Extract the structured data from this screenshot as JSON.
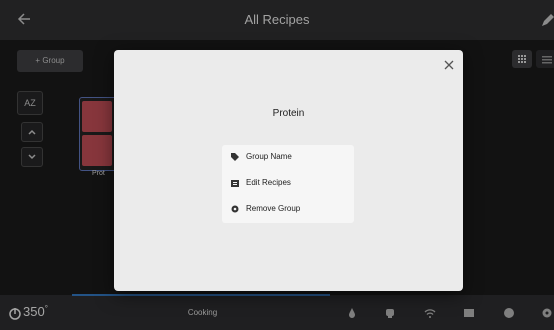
{
  "header": {
    "title": "All Recipes",
    "back_icon": "arrow-left-icon",
    "edit_icon": "pencil-icon"
  },
  "toolbar": {
    "add_group_label": "+ Group",
    "sort_label": "AZ"
  },
  "groups": [
    {
      "label": "Prot"
    }
  ],
  "modal": {
    "title": "Protein",
    "menu": [
      {
        "label": "Group Name",
        "icon": "tag-icon"
      },
      {
        "label": "Edit Recipes",
        "icon": "edit-list-icon"
      },
      {
        "label": "Remove Group",
        "icon": "gear-icon"
      }
    ]
  },
  "bottombar": {
    "temperature": "350",
    "temperature_unit": "°",
    "status": "Cooking"
  },
  "colors": {
    "accent": "#2f6fb3",
    "thumb": "#b54850"
  }
}
